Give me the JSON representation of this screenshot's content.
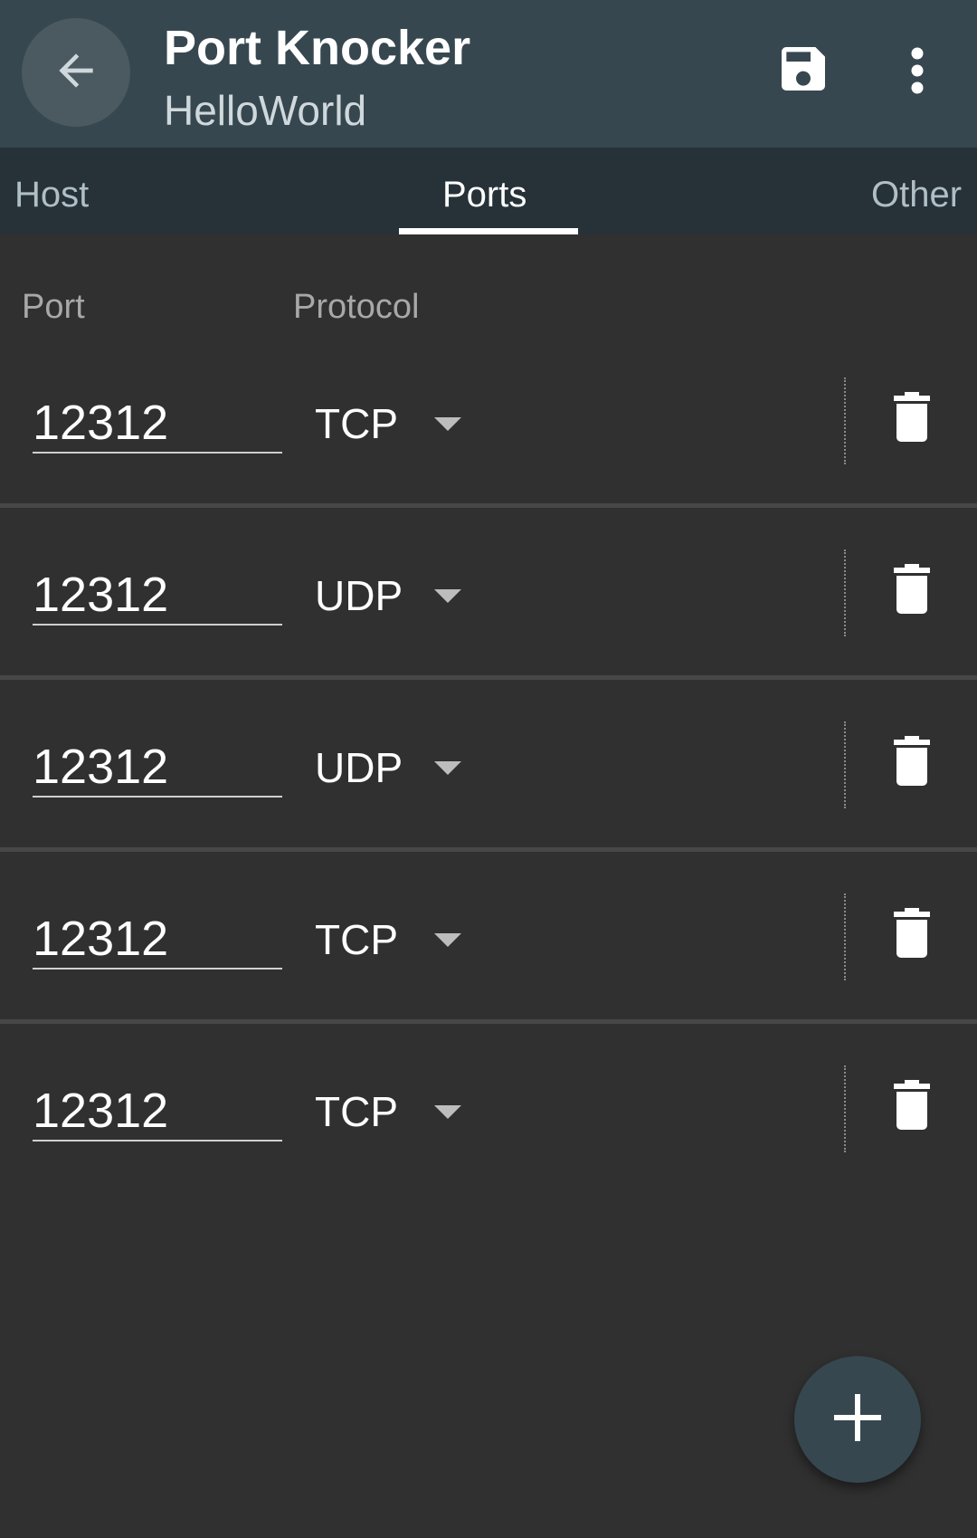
{
  "appbar": {
    "title": "Port Knocker",
    "subtitle": "HelloWorld",
    "back_icon": "arrow-back-icon",
    "save_icon": "floppy-disk-icon",
    "more_icon": "more-vert-icon"
  },
  "tabs": [
    {
      "label": "Host",
      "active": false
    },
    {
      "label": "Ports",
      "active": true
    },
    {
      "label": "Other",
      "active": false
    }
  ],
  "table": {
    "port_header": "Port",
    "protocol_header": "Protocol"
  },
  "rows": [
    {
      "port": "12312",
      "protocol": "TCP"
    },
    {
      "port": "12312",
      "protocol": "UDP"
    },
    {
      "port": "12312",
      "protocol": "UDP"
    },
    {
      "port": "12312",
      "protocol": "TCP"
    },
    {
      "port": "12312",
      "protocol": "TCP"
    }
  ],
  "row_icons": {
    "dropdown": "arrow-drop-down-icon",
    "delete": "trash-icon"
  },
  "fab": {
    "icon": "plus-icon"
  },
  "colors": {
    "appbar": "#37474f",
    "tabbar": "#263238",
    "background": "#303030",
    "fab": "#37474f"
  }
}
